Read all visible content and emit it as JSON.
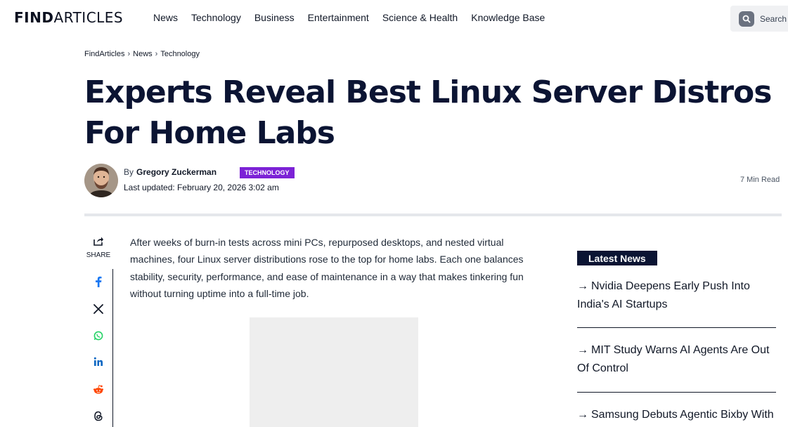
{
  "header": {
    "logo_bold": "FIND",
    "logo_light": "ARTICLES",
    "nav": [
      "News",
      "Technology",
      "Business",
      "Entertainment",
      "Science & Health",
      "Knowledge Base"
    ],
    "search_label": "Search"
  },
  "breadcrumb": {
    "items": [
      "FindArticles",
      "News",
      "Technology"
    ],
    "separator": "›"
  },
  "article": {
    "title": "Experts Reveal Best Linux Server Distros For Home Labs",
    "by": "By",
    "author": "Gregory Zuckerman",
    "category": "TECHNOLOGY",
    "updated": "Last updated: February 20, 2026 3:02 am",
    "read_time": "7 Min Read",
    "intro": "After weeks of burn-in tests across mini PCs, repurposed desktops, and nested virtual machines, four Linux server distributions rose to the top for home labs. Each one balances stability, security, performance, and ease of maintenance in a way that makes tinkering fun without turning uptime into a full-time job."
  },
  "share": {
    "label": "SHARE",
    "networks": [
      "facebook-icon",
      "x-icon",
      "whatsapp-icon",
      "linkedin-icon",
      "reddit-icon",
      "threads-icon"
    ]
  },
  "sidebar": {
    "heading": "Latest News",
    "items": [
      "Nvidia Deepens Early Push Into India's AI Startups",
      "MIT Study Warns AI Agents Are Out Of Control",
      "Samsung Debuts Agentic Bixby With"
    ],
    "arrow": "→"
  },
  "colors": {
    "title": "#0b1433",
    "badge": "#7c22d6",
    "latest_head_bg": "#0b1433",
    "facebook": "#1877f2",
    "whatsapp": "#25d366",
    "linkedin": "#0a66c2",
    "reddit": "#ff4500"
  }
}
